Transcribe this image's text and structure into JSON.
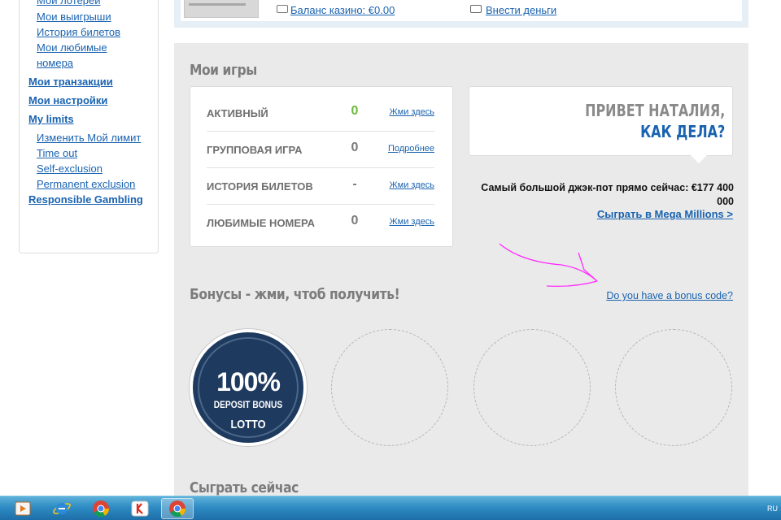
{
  "sidebar": {
    "items": [
      {
        "label": "Мои лотереи"
      },
      {
        "label": "Мои выигрыши"
      },
      {
        "label": "История билетов"
      },
      {
        "label": "Мои любимые"
      },
      {
        "label": "номера"
      },
      {
        "label": "Мои транзакции"
      },
      {
        "label": "Мои настройки"
      },
      {
        "label": "My limits"
      },
      {
        "label": "Изменить Мой лимит"
      },
      {
        "label": "Time out"
      },
      {
        "label": "Self-exclusion"
      },
      {
        "label": "Permanent exclusion"
      },
      {
        "label": "Responsible Gambling"
      }
    ]
  },
  "top_bar": {
    "casino_balance": "Баланс казино: €0.00",
    "deposit": "Внести деньги"
  },
  "my_games": {
    "title": "Мои игры",
    "rows": [
      {
        "label": "АКТИВНЫЙ",
        "value": "0",
        "link": "Жми здесь"
      },
      {
        "label": "ГРУППОВАЯ ИГРА",
        "value": "0",
        "link": "Подробнее"
      },
      {
        "label": "ИСТОРИЯ БИЛЕТОВ",
        "value": "-",
        "link": "Жми здесь"
      },
      {
        "label": "ЛЮБИМЫЕ НОМЕРА",
        "value": "0",
        "link": "Жми здесь"
      }
    ]
  },
  "greeting": {
    "line1": "ПРИВЕТ НАТАЛИЯ,",
    "line2": "КАК ДЕЛА?"
  },
  "jackpot": {
    "text": "Самый большой джэк-пот прямо сейчас: €177 400 000",
    "link": "Сыграть в Mega Millions >"
  },
  "bonuses": {
    "title": "Бонусы - жми, чтоб получить!",
    "code_link": "Do you have a bonus code?",
    "badge_percent": "100%",
    "badge_label": "DEPOSIT BONUS",
    "badge_brand": "LOTTO"
  },
  "play_now": {
    "title": "Сыграть сейчас"
  },
  "taskbar": {
    "language": "RU"
  },
  "colors": {
    "link": "#1a63b0",
    "active_green": "#6bb93a",
    "badge_navy": "#1e3a5f",
    "annotation_magenta": "#ff00ff"
  }
}
